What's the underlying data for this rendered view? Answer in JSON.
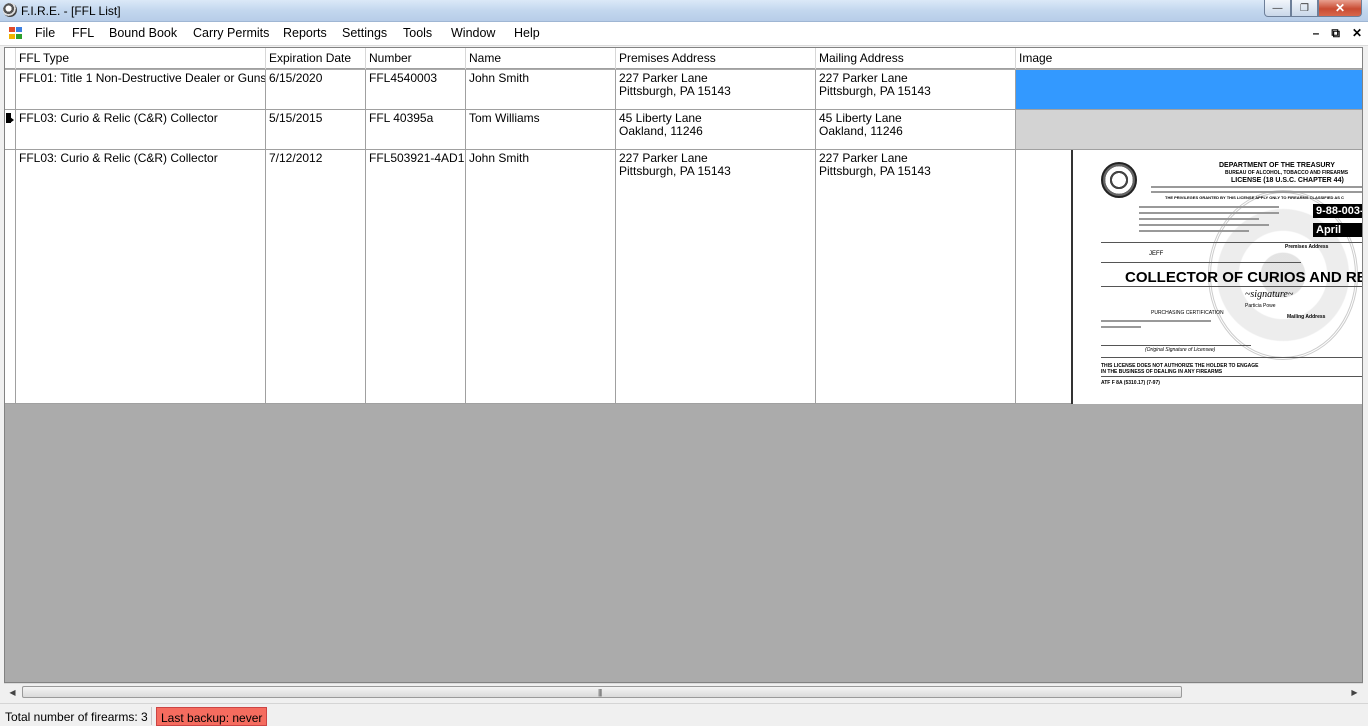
{
  "window": {
    "title": "F.I.R.E. - [FFL List]",
    "controls": [
      "minimize",
      "maximize",
      "close"
    ]
  },
  "menu": {
    "items": [
      "File",
      "FFL",
      "Bound Book",
      "Carry Permits",
      "Reports",
      "Settings",
      "Tools",
      "Window",
      "Help"
    ],
    "mdi_controls": [
      "–",
      "⧉",
      "✕"
    ]
  },
  "grid": {
    "columns": [
      "FFL Type",
      "Expiration Date",
      "Number",
      "Name",
      "Premises Address",
      "Mailing Address",
      "Image"
    ],
    "rows": [
      {
        "ffl_type": "FFL01: Title 1 Non-Destructive Dealer or Gunsmith",
        "expiration": "6/15/2020",
        "number": "FFL4540003",
        "name": "John Smith",
        "premises_line1": "227 Parker Lane",
        "premises_line2": "Pittsburgh, PA 15143",
        "mailing_line1": "227 Parker Lane",
        "mailing_line2": "Pittsburgh, PA 15143",
        "image": "selected-blue"
      },
      {
        "ffl_type": "FFL03: Curio & Relic (C&R) Collector",
        "expiration": "5/15/2015",
        "number": "FFL 40395a",
        "name": "Tom Williams",
        "premises_line1": "45 Liberty Lane",
        "premises_line2": "Oakland, 11246",
        "mailing_line1": "45 Liberty Lane",
        "mailing_line2": "Oakland, 11246",
        "image": "empty-gray",
        "current": true
      },
      {
        "ffl_type": "FFL03: Curio & Relic (C&R) Collector",
        "expiration": "7/12/2012",
        "number": "FFL503921-4AD1",
        "name": "John Smith",
        "premises_line1": "227 Parker Lane",
        "premises_line2": "Pittsburgh, PA 15143",
        "mailing_line1": "227 Parker Lane",
        "mailing_line2": "Pittsburgh, PA 15143",
        "image": "license-scan"
      }
    ]
  },
  "license_image": {
    "dept": "DEPARTMENT OF THE TREASURY",
    "bureau": "BUREAU OF ALCOHOL, TOBACCO AND FIREARMS",
    "license_title": "LICENSE (18 U.S.C. CHAPTER 44)",
    "privileges": "THE PRIVILEGES GRANTED BY THIS LICENSE APPLY ONLY TO FIREARMS CLASSIFIED AS C",
    "license_no": "9-88-003-",
    "month": "April",
    "name": "JEFF",
    "type": "COLLECTOR OF CURIOS AND RE",
    "signer": "Particia Powe",
    "purchasing": "PURCHASING CERTIFICATION",
    "premises": "Premises Address",
    "mailing": "Mailing Address",
    "original_sig": "(Original Signature of Licensee)",
    "warning1": "THIS LICENSE DOES NOT AUTHORIZE THE HOLDER TO ENGAGE",
    "warning2": "IN THE BUSINESS OF DEALING IN ANY FIREARMS",
    "form": "ATF F 8A (5310.17) (7-97)"
  },
  "status": {
    "count": "Total number of firearms: 3",
    "backup": "Last backup: never"
  },
  "colors": {
    "selection": "#3399ff",
    "empty_cell": "#d3d3d3",
    "backup_warning": "#f56c5f",
    "grid_background": "#ababab"
  }
}
